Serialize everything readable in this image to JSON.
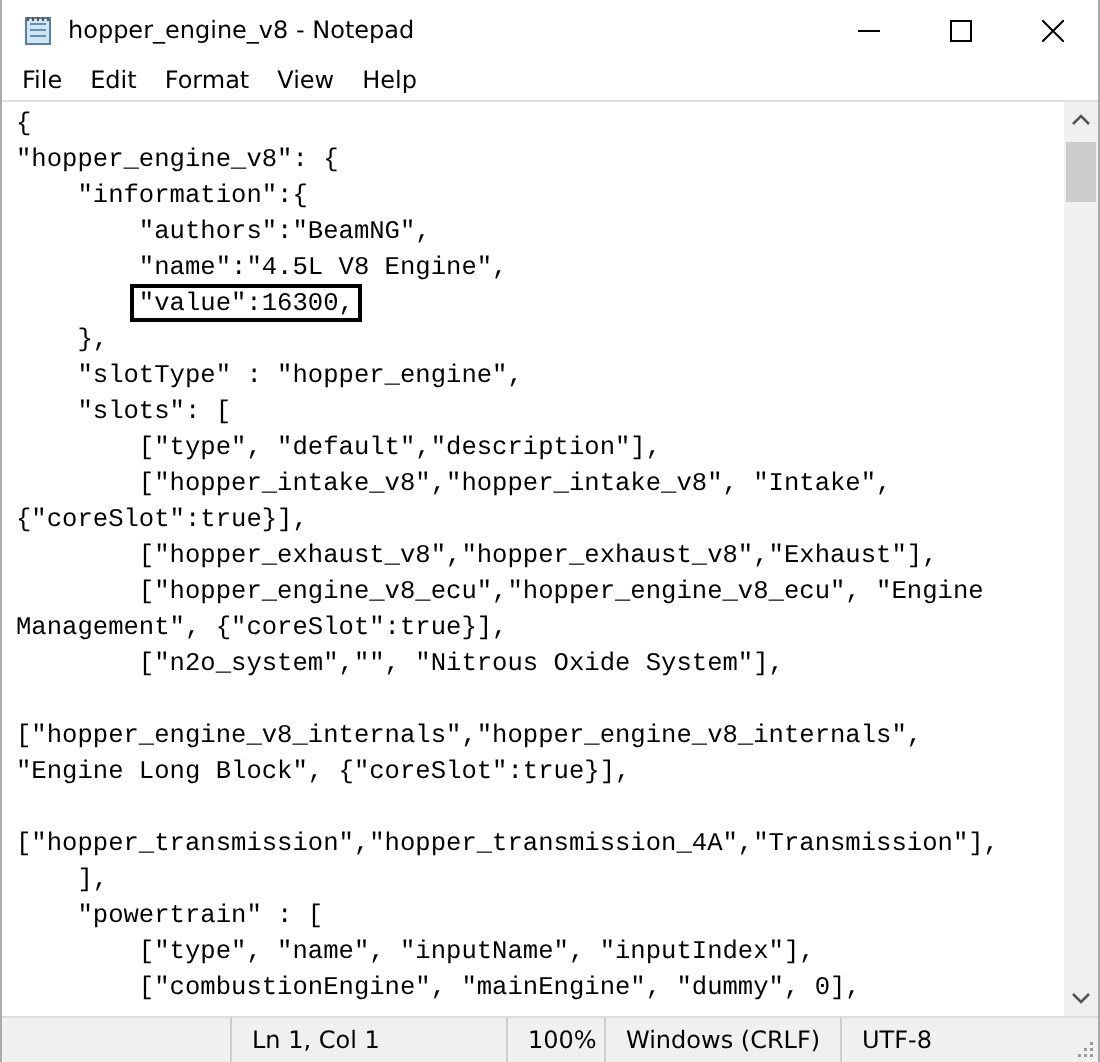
{
  "window": {
    "title": "hopper_engine_v8 - Notepad"
  },
  "menu": [
    "File",
    "Edit",
    "Format",
    "View",
    "Help"
  ],
  "editor": {
    "lines": [
      {
        "kind": "text",
        "text": "{"
      },
      {
        "kind": "text",
        "text": "\"hopper_engine_v8\": {"
      },
      {
        "kind": "text",
        "text": "    \"information\":{"
      },
      {
        "kind": "text",
        "text": "        \"authors\":\"BeamNG\","
      },
      {
        "kind": "text",
        "text": "        \"name\":\"4.5L V8 Engine\","
      },
      {
        "kind": "boxed",
        "text": "\"value\":16300,"
      },
      {
        "kind": "text",
        "text": "    },"
      },
      {
        "kind": "text",
        "text": "    \"slotType\" : \"hopper_engine\","
      },
      {
        "kind": "text",
        "text": "    \"slots\": ["
      },
      {
        "kind": "text",
        "text": "        [\"type\", \"default\",\"description\"],"
      },
      {
        "kind": "text",
        "text": "        [\"hopper_intake_v8\",\"hopper_intake_v8\", \"Intake\","
      },
      {
        "kind": "text",
        "text": "{\"coreSlot\":true}],"
      },
      {
        "kind": "text",
        "text": "        [\"hopper_exhaust_v8\",\"hopper_exhaust_v8\",\"Exhaust\"],"
      },
      {
        "kind": "text",
        "text": "        [\"hopper_engine_v8_ecu\",\"hopper_engine_v8_ecu\", \"Engine"
      },
      {
        "kind": "text",
        "text": "Management\", {\"coreSlot\":true}],"
      },
      {
        "kind": "text",
        "text": "        [\"n2o_system\",\"\", \"Nitrous Oxide System\"],"
      },
      {
        "kind": "blank"
      },
      {
        "kind": "text",
        "text": "[\"hopper_engine_v8_internals\",\"hopper_engine_v8_internals\","
      },
      {
        "kind": "text",
        "text": "\"Engine Long Block\", {\"coreSlot\":true}],"
      },
      {
        "kind": "blank"
      },
      {
        "kind": "text",
        "text": "[\"hopper_transmission\",\"hopper_transmission_4A\",\"Transmission\"],"
      },
      {
        "kind": "text",
        "text": "    ],"
      },
      {
        "kind": "text",
        "text": "    \"powertrain\" : ["
      },
      {
        "kind": "text",
        "text": "        [\"type\", \"name\", \"inputName\", \"inputIndex\"],"
      },
      {
        "kind": "text",
        "text": "        [\"combustionEngine\", \"mainEngine\", \"dummy\", 0],"
      }
    ]
  },
  "status_bar": [
    "Ln 1, Col 1",
    "100%",
    "Windows (CRLF)",
    "UTF-8"
  ]
}
